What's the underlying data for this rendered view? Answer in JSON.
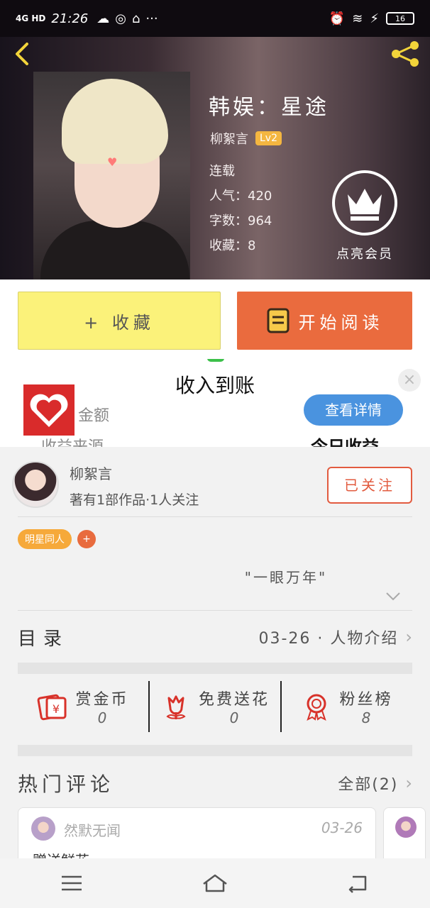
{
  "status_bar": {
    "network": "4G HD",
    "time": "21:26",
    "battery": "16"
  },
  "header": {
    "book_title": "韩娱：星途",
    "author": "柳絮言",
    "level": "Lv2",
    "status": "连载",
    "popularity": "人气：420",
    "word_count": "字数：964",
    "collections": "收藏：8",
    "vip_label": "点亮会员"
  },
  "buttons": {
    "collect": "+ 收藏",
    "read": "开始阅读"
  },
  "popup": {
    "title": "收入到账",
    "amount_label": "金额",
    "source_label": "收益来源",
    "detail_button": "查看详情",
    "today_label": "今日收益",
    "close": "×"
  },
  "author_card": {
    "name": "柳絮言",
    "stats": "著有1部作品·1人关注",
    "follow_button": "已关注"
  },
  "tags": [
    {
      "label": "明星同人"
    }
  ],
  "tag_add": "+",
  "intro": "\"一眼万年\"",
  "toc": {
    "label": "目录",
    "latest": "03-26 · 人物介绍",
    "chevron": "›"
  },
  "actions": [
    {
      "label": "赏金币",
      "value": "0",
      "icon": "red-envelope-icon"
    },
    {
      "label": "免费送花",
      "value": "0",
      "icon": "flower-icon"
    },
    {
      "label": "粉丝榜",
      "value": "8",
      "icon": "medal-icon"
    }
  ],
  "hot_comments": {
    "title": "热门评论",
    "all": "全部(2)",
    "chevron": "›",
    "items": [
      {
        "user": "然默无闻",
        "date": "03-26",
        "text": "赠送鲜花~"
      }
    ]
  },
  "colors": {
    "accent": "#ea6b3e",
    "collect_bg": "#fbf27a",
    "tag": "#f6a93a",
    "detail_blue": "#4a93df"
  }
}
